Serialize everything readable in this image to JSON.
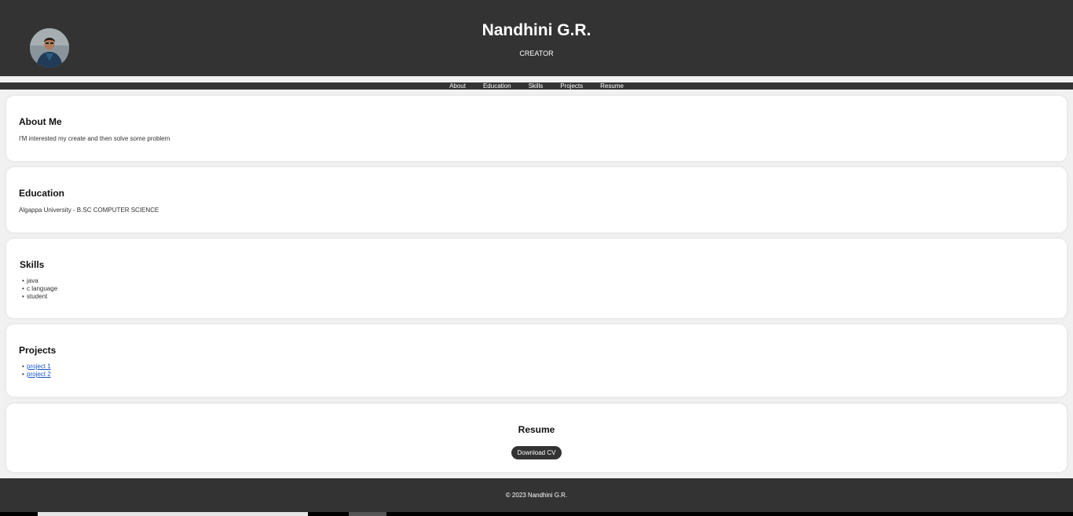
{
  "header": {
    "name": "Nandhini G.R.",
    "role": "CREATOR"
  },
  "nav": {
    "items": [
      {
        "label": "About"
      },
      {
        "label": "Education"
      },
      {
        "label": "Skills"
      },
      {
        "label": "Projects"
      },
      {
        "label": "Resume"
      }
    ]
  },
  "about": {
    "heading": "About Me",
    "text": "I'M interested my create and then solve some problem"
  },
  "education": {
    "heading": "Education",
    "text": "Algappa University - B.SC COMPUTER SCIENCE"
  },
  "skills": {
    "heading": "Skills",
    "items": [
      "java",
      "c language",
      "student"
    ]
  },
  "projects": {
    "heading": "Projects",
    "items": [
      "project 1",
      "project 2"
    ]
  },
  "resume": {
    "heading": "Resume",
    "button_label": "Download CV"
  },
  "footer": {
    "text": "© 2023 Nandhini G.R."
  },
  "colors": {
    "header_bg": "#333333",
    "page_bg": "#f1f1f1",
    "card_bg": "#ffffff",
    "link": "#1a55c8"
  }
}
